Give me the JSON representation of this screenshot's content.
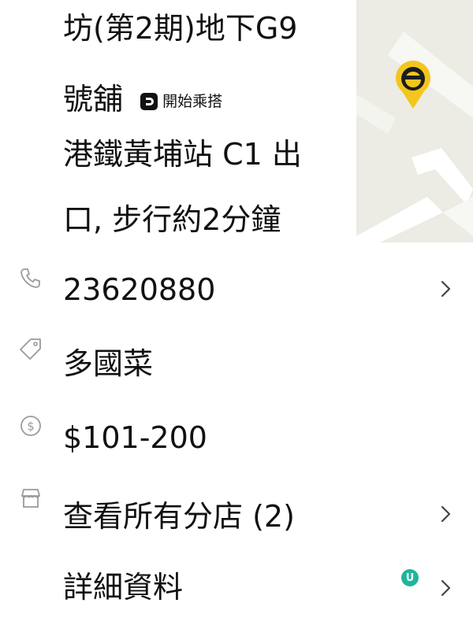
{
  "address": {
    "line1": "坊(第2期)地下G9",
    "line2": "號舖",
    "ride_label": "開始乘搭",
    "line3": "港鐵黃埔站 C1 出",
    "line4": "口, 步行約2分鐘"
  },
  "rows": {
    "phone": "23620880",
    "cuisine": "多國菜",
    "price": "$101-200",
    "branches": "查看所有分店 (2)",
    "details": "詳細資料"
  },
  "badge": {
    "letter": "U"
  },
  "colors": {
    "pin": "#f3c61e",
    "icon_gray": "#9a9a9a",
    "map_bg": "#ecebe4",
    "badge": "#1fb59a"
  }
}
